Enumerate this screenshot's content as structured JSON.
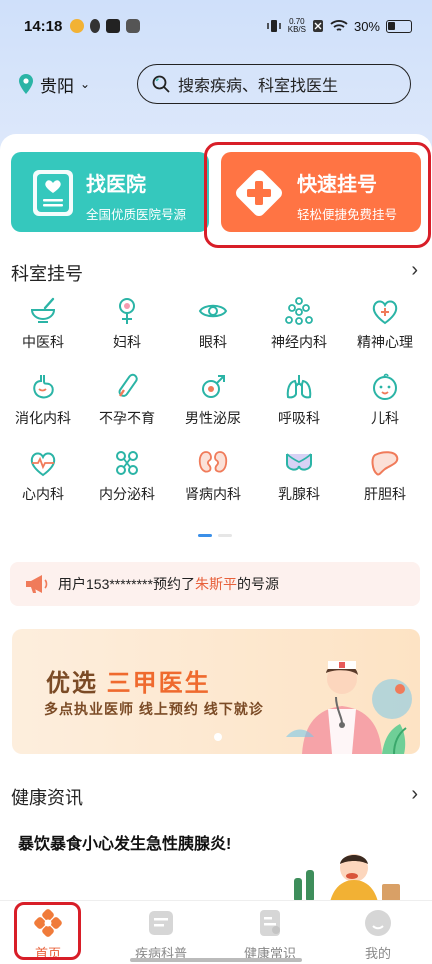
{
  "status_bar": {
    "time": "14:18",
    "net_speed_value": "0.70",
    "net_speed_unit": "KB/S",
    "battery": "30%"
  },
  "header": {
    "city": "贵阳",
    "search_placeholder": "搜索疾病、科室找医生"
  },
  "tiles": {
    "hospital": {
      "title": "找医院",
      "subtitle": "全国优质医院号源"
    },
    "register": {
      "title": "快速挂号",
      "subtitle": "轻松便捷免费挂号"
    }
  },
  "departments": {
    "title": "科室挂号",
    "items": [
      {
        "label": "中医科",
        "icon": "mortar-icon"
      },
      {
        "label": "妇科",
        "icon": "female-icon"
      },
      {
        "label": "眼科",
        "icon": "eye-icon"
      },
      {
        "label": "神经内科",
        "icon": "neuron-icon"
      },
      {
        "label": "精神心理",
        "icon": "heart-plus-icon"
      },
      {
        "label": "消化内科",
        "icon": "stomach-icon"
      },
      {
        "label": "不孕不育",
        "icon": "thermometer-icon"
      },
      {
        "label": "男性泌尿",
        "icon": "male-icon"
      },
      {
        "label": "呼吸科",
        "icon": "lungs-icon"
      },
      {
        "label": "儿科",
        "icon": "baby-face-icon"
      },
      {
        "label": "心内科",
        "icon": "heartbeat-icon"
      },
      {
        "label": "内分泌科",
        "icon": "molecule-icon"
      },
      {
        "label": "肾病内科",
        "icon": "kidney-icon"
      },
      {
        "label": "乳腺科",
        "icon": "bra-icon"
      },
      {
        "label": "肝胆科",
        "icon": "liver-icon"
      }
    ]
  },
  "notice": {
    "prefix": "用户153********预约了",
    "doctor": "朱斯平",
    "suffix": "的号源"
  },
  "banner": {
    "title_part1": "优选",
    "title_part2": "三甲医生",
    "subtitle": "多点执业医师 线上预约 线下就诊"
  },
  "news": {
    "section_title": "健康资讯",
    "headline": "暴饮暴食小心发生急性胰腺炎!"
  },
  "bottom_nav": [
    {
      "label": "首页",
      "active": true
    },
    {
      "label": "疾病科普",
      "active": false
    },
    {
      "label": "健康常识",
      "active": false
    },
    {
      "label": "我的",
      "active": false
    }
  ],
  "colors": {
    "teal": "#35c8bd",
    "orange": "#ff7444",
    "highlight_red": "#d81e28",
    "icon_teal": "#2bb4a6"
  }
}
